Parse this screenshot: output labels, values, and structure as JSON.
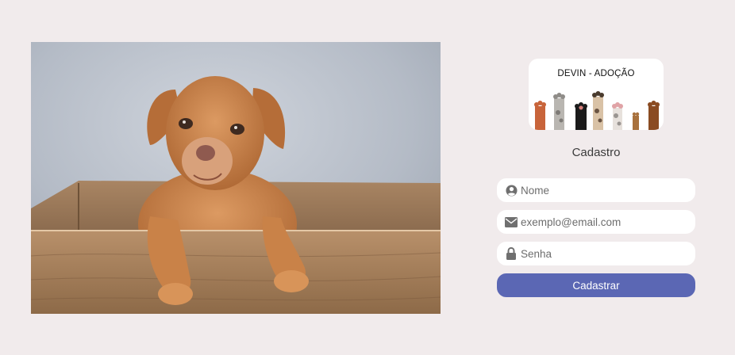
{
  "hero": {
    "image_description": "puppy-in-wooden-crate"
  },
  "logo": {
    "title": "DEVIN - ADOÇÃO",
    "paw_colors": [
      "#c8643a",
      "#b9b6b1",
      "#1b1b1b",
      "#d9c2a6",
      "#e7e1dc",
      "#a8713d",
      "#8a4b22"
    ]
  },
  "form": {
    "title": "Cadastro",
    "name": {
      "placeholder": "Nome",
      "icon": "user-circle-icon",
      "value": ""
    },
    "email": {
      "placeholder": "exemplo@email.com",
      "icon": "envelope-icon",
      "value": ""
    },
    "password": {
      "placeholder": "Senha",
      "icon": "lock-icon",
      "value": ""
    },
    "submit_label": "Cadastrar"
  },
  "colors": {
    "background": "#f1ebec",
    "accent": "#5b67b4",
    "field_bg": "#ffffff",
    "icon": "#6f6f6f"
  }
}
